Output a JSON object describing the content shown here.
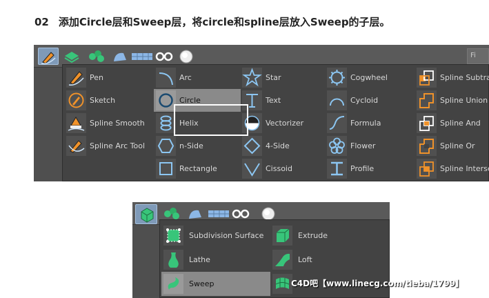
{
  "step": {
    "number": "02",
    "text": "添加Circle层和Sweep层，将circle和spline层放入Sweep的子层。"
  },
  "panel1": {
    "toolbar_right_label": "Fi",
    "toolbar_icons": [
      "spline-pen-icon",
      "generator-icon",
      "cloner-icon",
      "deformer-icon",
      "floor-icon",
      "camera-icon",
      "light-icon"
    ],
    "columns": [
      {
        "items": [
          {
            "label": "Pen",
            "icon": "pen-icon"
          },
          {
            "label": "Sketch",
            "icon": "sketch-icon"
          },
          {
            "label": "Spline Smooth",
            "icon": "spline-smooth-icon"
          },
          {
            "label": "Spline Arc Tool",
            "icon": "spline-arc-tool-icon"
          }
        ]
      },
      {
        "items": [
          {
            "label": "Arc",
            "icon": "arc-icon"
          },
          {
            "label": "Circle",
            "icon": "circle-icon",
            "highlighted": true
          },
          {
            "label": "Helix",
            "icon": "helix-icon"
          },
          {
            "label": "n-Side",
            "icon": "n-side-icon"
          },
          {
            "label": "Rectangle",
            "icon": "rectangle-icon"
          }
        ]
      },
      {
        "items": [
          {
            "label": "Star",
            "icon": "star-icon"
          },
          {
            "label": "Text",
            "icon": "text-icon"
          },
          {
            "label": "Vectorizer",
            "icon": "vectorizer-icon"
          },
          {
            "label": "4-Side",
            "icon": "four-side-icon"
          },
          {
            "label": "Cissoid",
            "icon": "cissoid-icon"
          }
        ]
      },
      {
        "items": [
          {
            "label": "Cogwheel",
            "icon": "cogwheel-icon"
          },
          {
            "label": "Cycloid",
            "icon": "cycloid-icon"
          },
          {
            "label": "Formula",
            "icon": "formula-icon"
          },
          {
            "label": "Flower",
            "icon": "flower-icon"
          },
          {
            "label": "Profile",
            "icon": "profile-icon"
          }
        ]
      },
      {
        "items": [
          {
            "label": "Spline Subtract",
            "icon": "spline-subtract-icon"
          },
          {
            "label": "Spline Union",
            "icon": "spline-union-icon"
          },
          {
            "label": "Spline And",
            "icon": "spline-and-icon"
          },
          {
            "label": "Spline Or",
            "icon": "spline-or-icon"
          },
          {
            "label": "Spline Intersect",
            "icon": "spline-intersect-icon"
          }
        ]
      }
    ]
  },
  "panel2": {
    "columns": [
      {
        "items": [
          {
            "label": "Subdivision Surface",
            "icon": "subdivision-surface-icon"
          },
          {
            "label": "Lathe",
            "icon": "lathe-icon"
          },
          {
            "label": "Sweep",
            "icon": "sweep-icon",
            "highlighted": true
          }
        ]
      },
      {
        "items": [
          {
            "label": "Extrude",
            "icon": "extrude-icon"
          },
          {
            "label": "Loft",
            "icon": "loft-icon"
          }
        ]
      }
    ]
  },
  "watermark": "C4D吧【www.linecg.com/tieba/1799】",
  "colors": {
    "accent_orange": "#f0922a",
    "accent_blue": "#8cc6f2",
    "accent_green": "#38c57a",
    "highlight": "#8a8a8a",
    "menu_bg": "#434343"
  }
}
